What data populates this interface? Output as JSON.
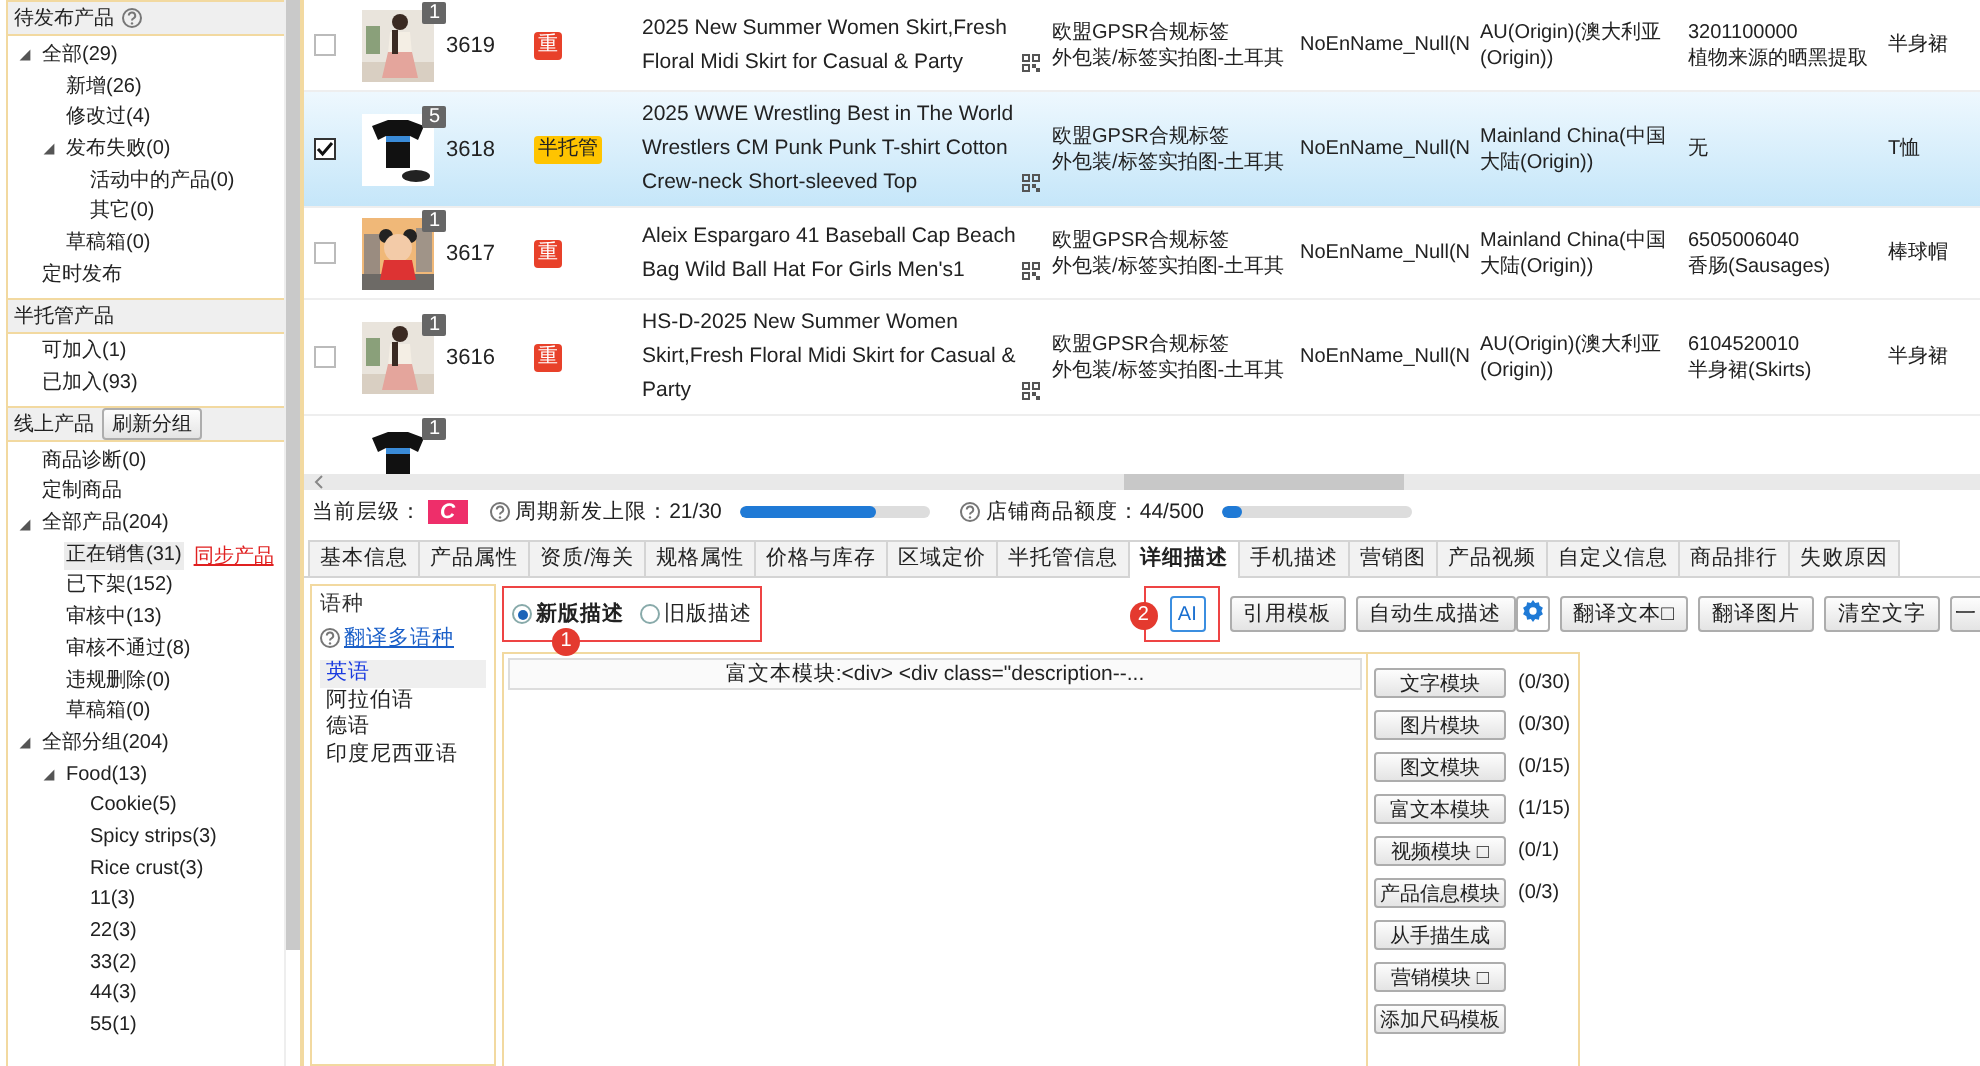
{
  "sidebar": {
    "sections": [
      {
        "title": "待发布产品",
        "help": true,
        "items": [
          {
            "label": "全部(29)",
            "selected": false,
            "expanded": true,
            "children": [
              {
                "label": "新增(26)",
                "selected": false
              },
              {
                "label": "修改过(4)",
                "selected": false
              },
              {
                "label": "发布失败(0)",
                "selected": false,
                "expanded": true,
                "children": [
                  {
                    "label": "活动中的产品(0)",
                    "selected": false
                  },
                  {
                    "label": "其它(0)",
                    "selected": false
                  }
                ]
              },
              {
                "label": "草稿箱(0)",
                "selected": false
              }
            ]
          },
          {
            "label": "定时发布",
            "selected": false
          }
        ]
      },
      {
        "title": "半托管产品",
        "help": false,
        "items": [
          {
            "label": "可加入(1)",
            "selected": false
          },
          {
            "label": "已加入(93)",
            "selected": false
          }
        ]
      },
      {
        "title": "线上产品",
        "help": false,
        "button": "刷新分组",
        "items": [
          {
            "label": "商品诊断(0)",
            "selected": false
          },
          {
            "label": "定制商品",
            "selected": false
          },
          {
            "label": "全部产品(204)",
            "selected": false,
            "expanded": true,
            "children": [
              {
                "label": "正在销售(31)",
                "selected": true,
                "link": "同步产品"
              },
              {
                "label": "已下架(152)",
                "selected": false
              },
              {
                "label": "审核中(13)",
                "selected": false
              },
              {
                "label": "审核不通过(8)",
                "selected": false
              },
              {
                "label": "违规删除(0)",
                "selected": false
              },
              {
                "label": "草稿箱(0)",
                "selected": false
              }
            ]
          },
          {
            "label": "全部分组(204)",
            "selected": false,
            "expanded": true,
            "children": [
              {
                "label": "Food(13)",
                "selected": false,
                "expanded": true,
                "children": [
                  {
                    "label": "Cookie(5)",
                    "selected": false
                  },
                  {
                    "label": "Spicy strips(3)",
                    "selected": false
                  },
                  {
                    "label": "Rice crust(3)",
                    "selected": false
                  },
                  {
                    "label": "11(3)",
                    "selected": false
                  },
                  {
                    "label": "22(3)",
                    "selected": false
                  },
                  {
                    "label": "33(2)",
                    "selected": false
                  },
                  {
                    "label": "44(3)",
                    "selected": false
                  },
                  {
                    "label": "55(1)",
                    "selected": false
                  }
                ]
              }
            ]
          }
        ]
      }
    ]
  },
  "table": {
    "rows": [
      {
        "checked": false,
        "selected": false,
        "count": "1",
        "id": "3619",
        "tag": {
          "kind": "red",
          "label": "重"
        },
        "title": "2025 New Summer Women Skirt,Fresh Floral Midi Skirt for Casual & Party",
        "gpsr": [
          "欧盟GPSR合规标签",
          "外包装/标签实拍图-土耳其"
        ],
        "name": "NoEnName_Null(N",
        "origin": [
          "AU(Origin)(澳大利亚",
          "(Origin))"
        ],
        "hs": [
          "3201100000",
          "植物来源的晒黑提取"
        ],
        "category": "半身裙"
      },
      {
        "checked": true,
        "selected": true,
        "count": "5",
        "id": "3618",
        "tag": {
          "kind": "yellow",
          "label": "半托管"
        },
        "title": "2025 WWE Wrestling Best in The World Wrestlers CM Punk Punk T-shirt Cotton Crew-neck Short-sleeved Top",
        "gpsr": [
          "欧盟GPSR合规标签",
          "外包装/标签实拍图-土耳其"
        ],
        "name": "NoEnName_Null(N",
        "origin": [
          "Mainland China(中国",
          "大陆(Origin))"
        ],
        "hs": [
          "无"
        ],
        "category": "T恤"
      },
      {
        "checked": false,
        "selected": false,
        "count": "1",
        "id": "3617",
        "tag": {
          "kind": "red",
          "label": "重"
        },
        "title": "Aleix Espargaro 41 Baseball Cap Beach Bag Wild Ball Hat For Girls Men's1",
        "gpsr": [
          "欧盟GPSR合规标签",
          "外包装/标签实拍图-土耳其"
        ],
        "name": "NoEnName_Null(N",
        "origin": [
          "Mainland China(中国",
          "大陆(Origin))"
        ],
        "hs": [
          "6505006040",
          "香肠(Sausages)"
        ],
        "category": "棒球帽"
      },
      {
        "checked": false,
        "selected": false,
        "count": "1",
        "id": "3616",
        "tag": {
          "kind": "red",
          "label": "重"
        },
        "title": "HS-D-2025 New Summer Women Skirt,Fresh Floral Midi Skirt for Casual & Party",
        "gpsr": [
          "欧盟GPSR合规标签",
          "外包装/标签实拍图-土耳其"
        ],
        "name": "NoEnName_Null(N",
        "origin": [
          "AU(Origin)(澳大利亚",
          "(Origin))"
        ],
        "hs": [
          "6104520010",
          "半身裙(Skirts)"
        ],
        "category": "半身裙"
      },
      {
        "selected": false,
        "count": "1"
      }
    ]
  },
  "status": {
    "label": "当前层级：",
    "badge": "C",
    "quotas": [
      {
        "label": "周期新发上限：21/30",
        "level": 0.72
      },
      {
        "label": "店铺商品额度：44/500",
        "level": 0.1
      }
    ]
  },
  "tabs": [
    {
      "label": "基本信息",
      "selected": false
    },
    {
      "label": "产品属性",
      "selected": false
    },
    {
      "label": "资质/海关",
      "selected": false
    },
    {
      "label": "规格属性",
      "selected": false
    },
    {
      "label": "价格与库存",
      "selected": false
    },
    {
      "label": "区域定价",
      "selected": false
    },
    {
      "label": "半托管信息",
      "selected": false
    },
    {
      "label": "详细描述",
      "selected": true
    },
    {
      "label": "手机描述",
      "selected": false
    },
    {
      "label": "营销图",
      "selected": false
    },
    {
      "label": "产品视频",
      "selected": false
    },
    {
      "label": "自定义信息",
      "selected": false
    },
    {
      "label": "商品排行",
      "selected": false
    },
    {
      "label": "失败原因",
      "selected": false
    }
  ],
  "description": {
    "languages": {
      "title": "语种",
      "link": "翻译多语种",
      "items": [
        {
          "label": "英语",
          "selected": true
        },
        {
          "label": "阿拉伯语",
          "selected": false
        },
        {
          "label": "德语",
          "selected": false
        },
        {
          "label": "印度尼西亚语",
          "selected": false
        }
      ]
    },
    "mode": {
      "callout": "1",
      "options": [
        {
          "label": "新版描述",
          "selected": true
        },
        {
          "label": "旧版描述",
          "selected": false
        }
      ]
    },
    "ai": {
      "callout": "2",
      "label": "AI"
    },
    "buttons": [
      {
        "label": "引用模板",
        "gear": false
      },
      {
        "label": "自动生成描述",
        "gear": true
      },
      {
        "label": "翻译文本□",
        "gear": false
      },
      {
        "label": "翻译图片",
        "gear": false
      },
      {
        "label": "清空文字",
        "gear": false
      },
      {
        "label": "一",
        "gear": false
      }
    ],
    "module_header": "富文本模块:<div> <div class=\"description--...",
    "modules": [
      {
        "label": "文字模块",
        "count": "(0/30)"
      },
      {
        "label": "图片模块",
        "count": "(0/30)"
      },
      {
        "label": "图文模块",
        "count": "(0/15)"
      },
      {
        "label": "富文本模块",
        "count": "(1/15)"
      },
      {
        "label": "视频模块 □",
        "count": "(0/1)"
      },
      {
        "label": "产品信息模块",
        "count": "(0/3)"
      },
      {
        "label": "从手描生成"
      },
      {
        "label": "营销模块 □"
      },
      {
        "label": "添加尺码模板"
      }
    ]
  }
}
